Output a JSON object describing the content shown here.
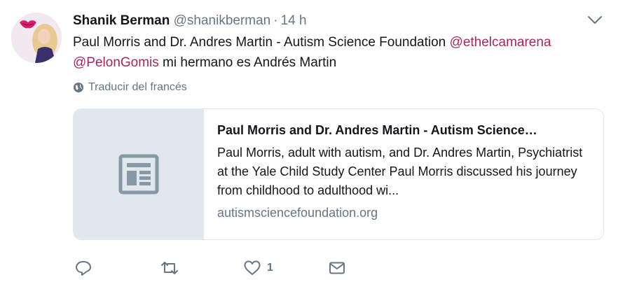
{
  "tweet": {
    "name": "Shanik Berman",
    "handle": "@shanikberman",
    "separator": "·",
    "time": "14 h",
    "text_part1": "Paul Morris and Dr. Andres Martin - Autism Science Foundation ",
    "mention1": "@ethelcamarena",
    "mention2": "@PelonGomis",
    "text_part2": " mi hermano es Andrés Martin",
    "translate_label": "Traducir del francés",
    "mention_color": "#a7275c"
  },
  "card": {
    "title": "Paul Morris and Dr. Andres Martin - Autism Science…",
    "description": "Paul Morris, adult with autism, and Dr. Andres Martin, Psychiatrist at the Yale Child Study Center Paul Morris discussed his journey from childhood to adulthood wi...",
    "domain": "autismsciencefoundation.org",
    "thumb_icon": "article-icon"
  },
  "actions": {
    "reply_icon": "reply-icon",
    "retweet_icon": "retweet-icon",
    "like_icon": "like-icon",
    "like_count": "1",
    "dm_icon": "direct-message-icon"
  }
}
